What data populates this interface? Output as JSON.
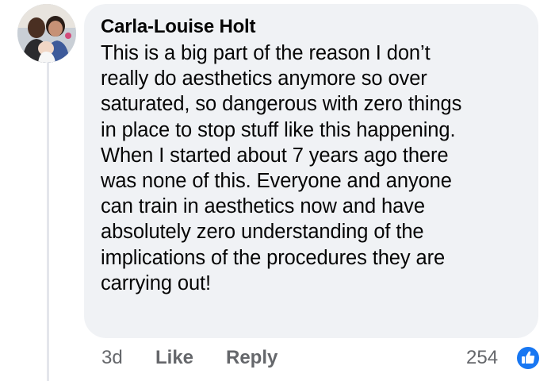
{
  "comment": {
    "author": "Carla-Louise Holt",
    "text": "This is a big part of the reason I don’t\nreally do aesthetics anymore so over\nsaturated, so dangerous with zero things\nin place to stop stuff like this happening.\nWhen I started about 7 years ago there\nwas none of this. Everyone and anyone\ncan train in aesthetics now and have\nabsolutely zero understanding of the\nimplications of the procedures they are\ncarrying out!",
    "timestamp": "3d",
    "like_label": "Like",
    "reply_label": "Reply",
    "reaction_count": "254",
    "reaction_icon": "like-thumb-icon"
  },
  "colors": {
    "bubble_bg": "#f0f2f5",
    "text": "#050505",
    "secondary_text": "#65676b",
    "like_blue": "#1877f2"
  }
}
